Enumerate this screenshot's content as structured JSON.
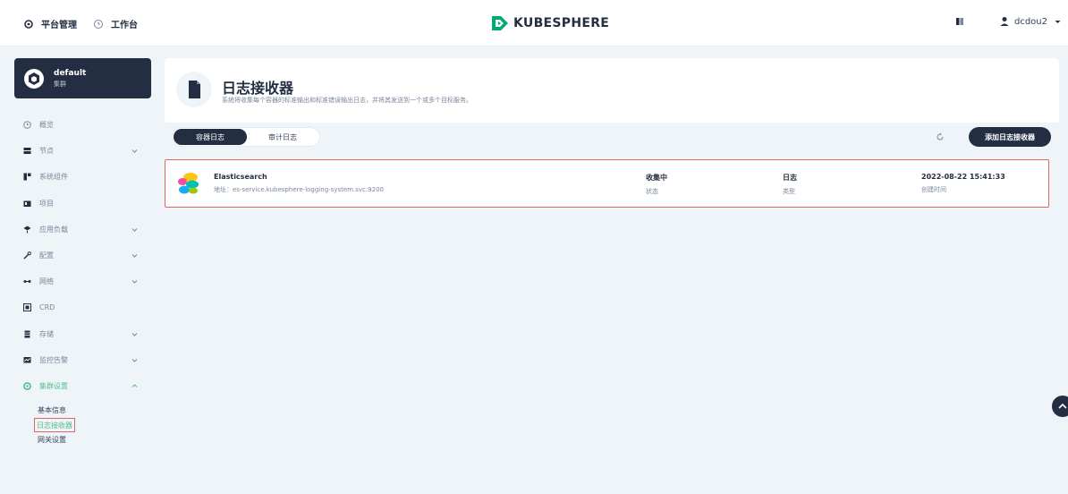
{
  "header": {
    "nav": [
      {
        "label": "平台管理",
        "icon": "gear-icon"
      },
      {
        "label": "工作台",
        "icon": "dashboard-icon"
      }
    ],
    "brand": "KUBESPHERE",
    "user": "dcdou2"
  },
  "cluster": {
    "name": "default",
    "type": "集群"
  },
  "sidebar": {
    "items": [
      {
        "label": "概览",
        "icon": "overview-icon",
        "expandable": false
      },
      {
        "label": "节点",
        "icon": "nodes-icon",
        "expandable": true
      },
      {
        "label": "系统组件",
        "icon": "components-icon",
        "expandable": false
      },
      {
        "label": "项目",
        "icon": "projects-icon",
        "expandable": false
      },
      {
        "label": "应用负载",
        "icon": "workloads-icon",
        "expandable": true
      },
      {
        "label": "配置",
        "icon": "config-icon",
        "expandable": true
      },
      {
        "label": "网络",
        "icon": "network-icon",
        "expandable": true
      },
      {
        "label": "CRD",
        "icon": "crd-icon",
        "expandable": false
      },
      {
        "label": "存储",
        "icon": "storage-icon",
        "expandable": true
      },
      {
        "label": "监控告警",
        "icon": "monitoring-icon",
        "expandable": true
      },
      {
        "label": "集群设置",
        "icon": "settings-icon",
        "expandable": true,
        "active": true
      }
    ],
    "subitems": [
      {
        "label": "基本信息"
      },
      {
        "label": "日志接收器",
        "active": true
      },
      {
        "label": "网关设置"
      }
    ]
  },
  "banner": {
    "title": "日志接收器",
    "description": "系统将收集每个容器的标准输出和标准错误输出日志，并将其发送到一个或多个目标服务。"
  },
  "tabs": [
    {
      "label": "容器日志",
      "active": true
    },
    {
      "label": "审计日志",
      "active": false
    }
  ],
  "toolbar": {
    "add_label": "添加日志接收器"
  },
  "receivers": [
    {
      "name": "Elasticsearch",
      "address": "地址：es-service.kubesphere-logging-system.svc:9200",
      "status_value": "收集中",
      "status_label": "状态",
      "type_value": "日志",
      "type_label": "类型",
      "time_value": "2022-08-22 15:41:33",
      "time_label": "创建时间"
    }
  ],
  "colors": {
    "dark": "#242e42",
    "accent": "#55bc8a",
    "highlight": "#e06666"
  }
}
